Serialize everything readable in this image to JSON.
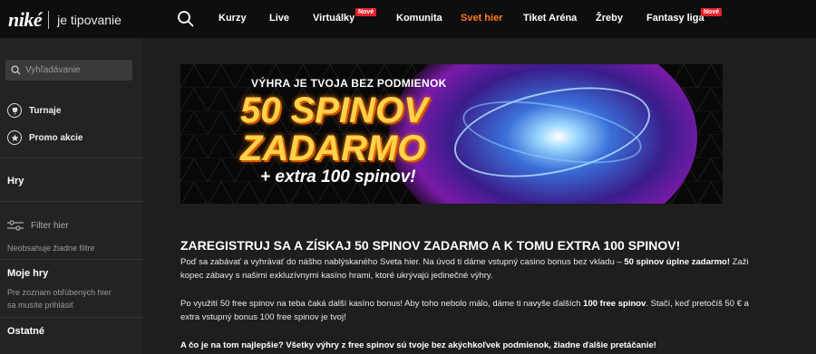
{
  "header": {
    "logo": "niké",
    "tagline": "je tipovanie",
    "nav": [
      {
        "label": "Kurzy"
      },
      {
        "label": "Live"
      },
      {
        "label": "Virtuálky",
        "badge": "Nové"
      },
      {
        "label": "Komunita"
      },
      {
        "label": "Svet hier",
        "active": true
      },
      {
        "label": "Tiket Aréna"
      },
      {
        "label": "Žreby"
      },
      {
        "label": "Fantasy liga",
        "badge": "Nové"
      }
    ]
  },
  "sidebar": {
    "search_placeholder": "Vyhľadávanie",
    "links": [
      {
        "label": "Turnaje",
        "icon": "tournament-icon"
      },
      {
        "label": "Promo akcie",
        "icon": "promo-icon"
      }
    ],
    "games_heading": "Hry",
    "filter_label": "Filter hier",
    "no_filters": "Neobsahuje žiadne filtre",
    "my_games_heading": "Moje hry",
    "my_games_text_1": "Pre zoznam obľúbených hier",
    "my_games_text_2": "sa musíte prihlásiť",
    "other_heading": "Ostatné"
  },
  "banner": {
    "line1": "VÝHRA JE TVOJA BEZ PODMIENOK",
    "line2": "50 SPINOV",
    "line3": "ZADARMO",
    "line4": "+ extra 100 spinov!"
  },
  "content": {
    "headline": "ZAREGISTRUJ SA A ZÍSKAJ 50 SPINOV ZADARMO A K TOMU EXTRA 100 SPINOV!",
    "p1_a": "Poď sa zabávať a vyhrávať do nášho nablýskaného Sveta hier. Na úvod ti dáme vstupný casino bonus bez vkladu – ",
    "p1_b": "50 spinov úplne zadarmo!",
    "p1_c": " Zaži kopec zábavy s našimi exkluzívnymi kasíno hrami, ktoré ukrývajú jedinečné výhry.",
    "p2_a": "Po využití 50 free spinov na teba čaká další kasíno bonus! Aby toho nebolo málo, dáme ti navyše ďalších ",
    "p2_b": "100 free spinov",
    "p2_c": ". Stačí, keď pretočíš 50 € a extra vstupný bonus 100 free spinov je tvoj!",
    "p3": "A čo je na tom najlepšie? Všetky výhry z free spinov sú tvoje bez akýchkoľvek podmienok, žiadne ďalšie pretáčanie!"
  },
  "colors": {
    "accent": "#ff7a1a",
    "badge": "#e8212c",
    "banner_text": "#ffd24a"
  }
}
